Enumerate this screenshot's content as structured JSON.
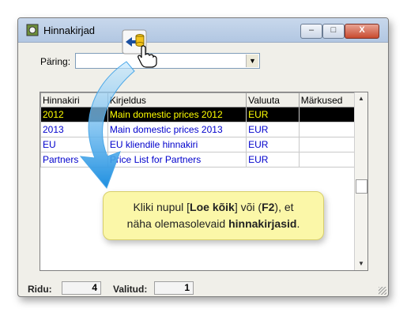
{
  "window": {
    "title": "Hinnakirjad",
    "min_label": "–",
    "max_label": "□",
    "close_label": "X"
  },
  "query": {
    "label": "Päring:",
    "value": ""
  },
  "table": {
    "columns": [
      "Hinnakiri",
      "Kirjeldus",
      "Valuuta",
      "Märkused"
    ],
    "rows": [
      {
        "hinnakiri": "2012",
        "kirjeldus": "Main domestic prices 2012",
        "valuuta": "EUR",
        "markused": ""
      },
      {
        "hinnakiri": "2013",
        "kirjeldus": "Main domestic prices 2013",
        "valuuta": "EUR",
        "markused": ""
      },
      {
        "hinnakiri": "EU",
        "kirjeldus": "EU kliendile hinnakiri",
        "valuuta": "EUR",
        "markused": ""
      },
      {
        "hinnakiri": "Partners",
        "kirjeldus": "Price List for Partners",
        "valuuta": "EUR",
        "markused": ""
      }
    ]
  },
  "status": {
    "rows_label": "Ridu:",
    "rows_value": "4",
    "selected_label": "Valitud:",
    "selected_value": "1"
  },
  "callout": {
    "text_1": "Kliki nupul [",
    "bold_1": "Loe kõik",
    "text_2": "] või (",
    "bold_2": "F2",
    "text_3": "), et",
    "text_4": "näha olemasolevaid ",
    "bold_3": "hinnakirjasid",
    "text_5": "."
  },
  "colors": {
    "selected_bg": "#000000",
    "selected_fg": "#ffff00",
    "row_fg": "#0000cc",
    "bubble_bg": "#fbf7a8"
  },
  "icons": [
    "app-icon",
    "load-all-icon",
    "hand-pointer-icon",
    "curved-arrow-icon",
    "scroll-up-icon",
    "scroll-down-icon",
    "resize-grip-icon"
  ]
}
